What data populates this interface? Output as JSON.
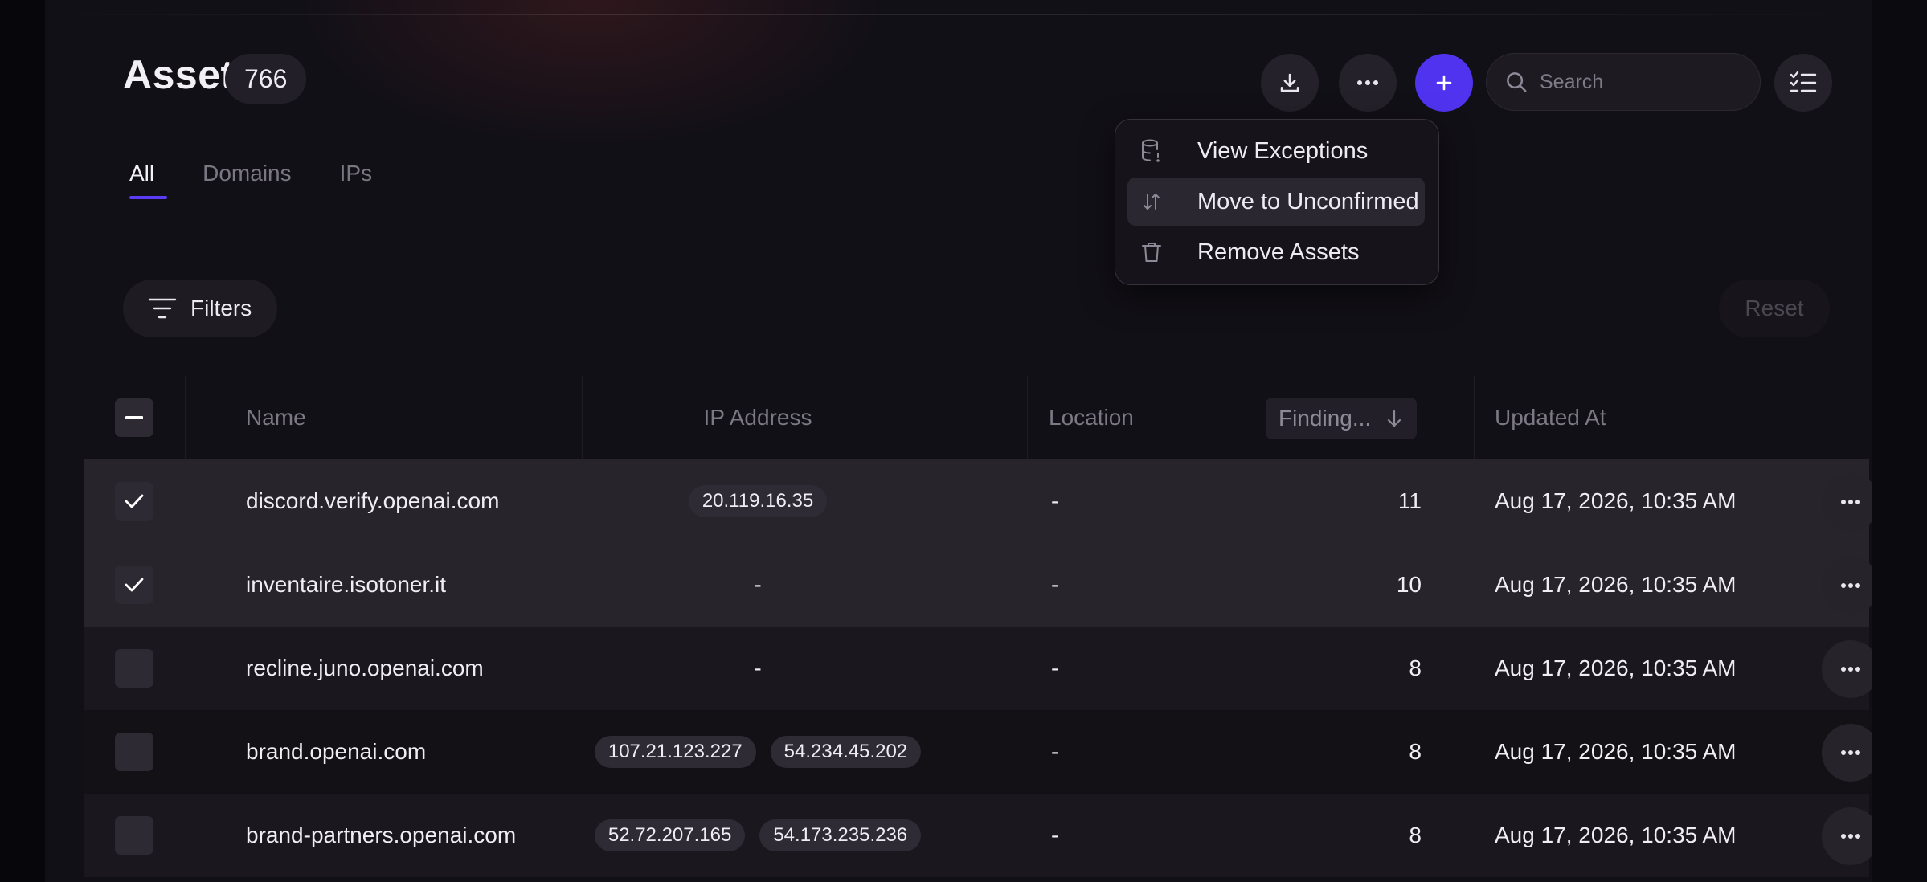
{
  "header": {
    "title": "Assets",
    "count": "766",
    "search_placeholder": "Search"
  },
  "tabs": [
    {
      "label": "All",
      "active": true
    },
    {
      "label": "Domains",
      "active": false
    },
    {
      "label": "IPs",
      "active": false
    }
  ],
  "toolbar": {
    "filters_label": "Filters",
    "reset_label": "Reset"
  },
  "dropdown": {
    "items": [
      {
        "label": "View Exceptions",
        "icon": "database-exception-icon"
      },
      {
        "label": "Move to Unconfirmed",
        "icon": "sort-arrows-icon"
      },
      {
        "label": "Remove Assets",
        "icon": "trash-icon"
      }
    ]
  },
  "table": {
    "columns": {
      "name": "Name",
      "ip": "IP Address",
      "location": "Location",
      "findings": "Finding...",
      "updated": "Updated At"
    },
    "rows": [
      {
        "name": "discord.verify.openai.com",
        "ips": [
          "20.119.16.35"
        ],
        "location": "-",
        "findings": "11",
        "updated": "Aug 17, 2026, 10:35 AM",
        "checked": true
      },
      {
        "name": "inventaire.isotoner.it",
        "ips": [],
        "ip_empty": "-",
        "location": "-",
        "findings": "10",
        "updated": "Aug 17, 2026, 10:35 AM",
        "checked": true
      },
      {
        "name": "recline.juno.openai.com",
        "ips": [],
        "ip_empty": "-",
        "location": "-",
        "findings": "8",
        "updated": "Aug 17, 2026, 10:35 AM",
        "checked": false
      },
      {
        "name": "brand.openai.com",
        "ips": [
          "107.21.123.227",
          "54.234.45.202"
        ],
        "location": "-",
        "findings": "8",
        "updated": "Aug 17, 2026, 10:35 AM",
        "checked": false
      },
      {
        "name": "brand-partners.openai.com",
        "ips": [
          "52.72.207.165",
          "54.173.235.236"
        ],
        "location": "-",
        "findings": "8",
        "updated": "Aug 17, 2026, 10:35 AM",
        "checked": false
      }
    ]
  },
  "colors": {
    "accent": "#4f33ef",
    "background": "#121017",
    "selected_row": "#27242c"
  }
}
